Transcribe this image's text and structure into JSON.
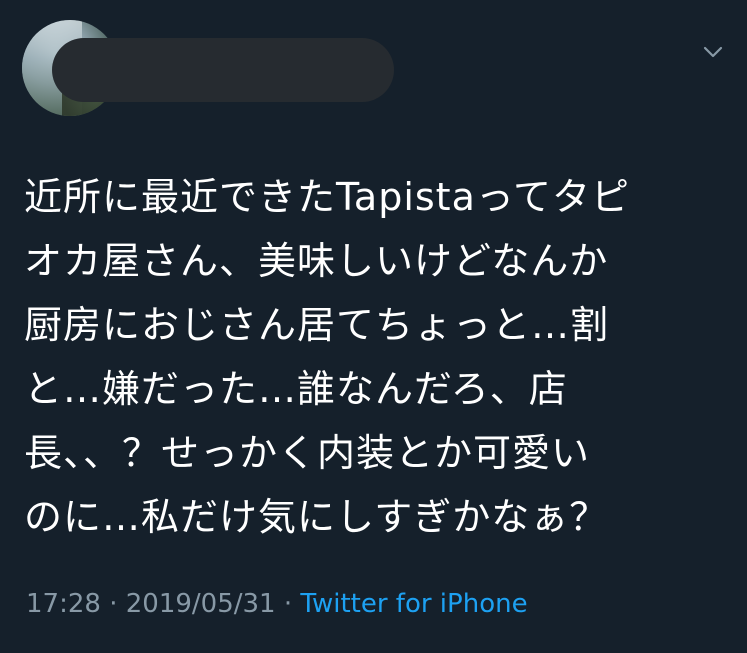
{
  "tweet": {
    "body_lines": [
      "近所に最近できたTapistaってタピ",
      "オカ屋さん、美味しいけどなんか",
      "厨房におじさん居てちょっと…割",
      "と…嫌だった…誰なんだろ、店",
      "長、、？せっかく内装とか可愛い",
      "のに…私だけ気にしすぎかなぁ？"
    ],
    "time": "17:28",
    "separator": " · ",
    "date": "2019/05/31",
    "source": "Twitter for iPhone"
  },
  "icons": {
    "more_menu": "chevron-down-icon"
  },
  "colors": {
    "background": "#15202b",
    "text": "#ffffff",
    "muted": "#8899a6",
    "link": "#1da1f2",
    "redaction": "#262b30"
  }
}
